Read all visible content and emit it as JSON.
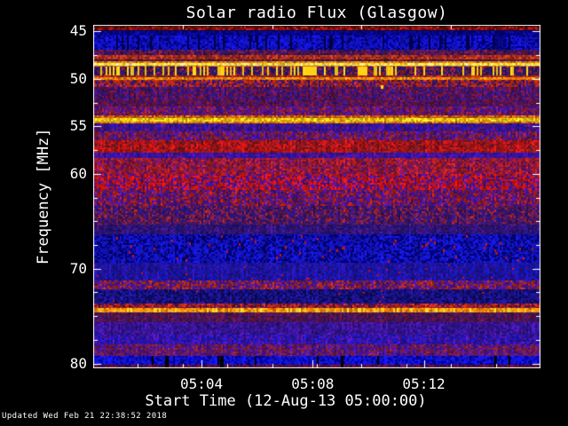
{
  "title": "Solar radio Flux (Glasgow)",
  "updated_note": "Updated Wed Feb 21 22:38:52 2018",
  "chart_data": {
    "type": "heatmap",
    "title": "Solar radio Flux (Glasgow)",
    "xlabel": "Start Time (12-Aug-13 05:00:00)",
    "ylabel": "Frequency [MHz]",
    "legend": "none",
    "grid": false,
    "colors": {
      "text": "#ffffff",
      "frame": "#ffffff",
      "background": "#000000"
    },
    "x_axis": {
      "label": "Start Time (12-Aug-13 05:00:00)",
      "unit": "minutes after 05:00:00",
      "range_minutes": [
        0.1,
        16.2
      ],
      "ticks": [
        {
          "t": 4,
          "label": "05:04"
        },
        {
          "t": 8,
          "label": "05:08"
        },
        {
          "t": 12,
          "label": "05:12"
        }
      ],
      "minor_divisions_bottom": 10,
      "minor_divisions_top": 5
    },
    "y_axis": {
      "label": "Frequency [MHz]",
      "unit": "MHz",
      "range_mhz": [
        44.3,
        80.5
      ],
      "direction": "increasing-downward",
      "ticks": [
        {
          "f": 45,
          "label": "45"
        },
        {
          "f": 50,
          "label": "50"
        },
        {
          "f": 55,
          "label": "55"
        },
        {
          "f": 60,
          "label": "60"
        },
        {
          "f": 70,
          "label": "70"
        },
        {
          "f": 80,
          "label": "80"
        }
      ],
      "minor_step_mhz": 2.5
    },
    "bands": [
      {
        "f0": 44.35,
        "f1": 44.46,
        "a": "#2D0606",
        "b": "#000000",
        "pa": 0.6
      },
      {
        "f0": 44.46,
        "f1": 44.82,
        "a": "#960F0A",
        "b": "#5A0A0A",
        "pa": 0.6,
        "d": "#DC1E14",
        "dp": 0.3,
        "dh": 2
      },
      {
        "f0": 44.82,
        "f1": 44.96,
        "a": "#000064",
        "b": "#0A0A32",
        "pa": 0.6
      },
      {
        "f0": 44.96,
        "f1": 45.42,
        "a": "#0A0AA0",
        "b": "#000078",
        "pa": 0.6
      },
      {
        "f0": 45.42,
        "f1": 46.95,
        "a": "#1212CC",
        "b": "#000082",
        "pa": 0.72,
        "d": "#000046",
        "dp": 0.08,
        "dh": "full"
      },
      {
        "f0": 46.95,
        "f1": 47.52,
        "a": "#78193C",
        "b": "#28146E",
        "pa": 0.55
      },
      {
        "f0": 47.52,
        "f1": 47.95,
        "a": "#C83C14",
        "b": "#8C1E28",
        "pa": 0.6
      },
      {
        "f0": 47.95,
        "f1": 48.15,
        "a": "#32145A",
        "b": "#6E1E28",
        "pa": 0.6
      },
      {
        "f0": 48.15,
        "f1": 48.36,
        "a": "#FF8C0A",
        "b": "#DC640A",
        "pa": 0.7
      },
      {
        "f0": 48.36,
        "f1": 48.58,
        "a": "#FFE632",
        "b": "#FFF9A0",
        "pa": 0.65
      },
      {
        "f0": 48.58,
        "f1": 48.7,
        "a": "#FF7814",
        "b": "#DC500A",
        "pa": 0.6
      },
      {
        "f0": 48.7,
        "f1": 49.6,
        "a": "#28186E",
        "b": "#8C1E28",
        "pa": 0.6,
        "d": "#FFD216",
        "dp": 0.3,
        "dh": "full"
      },
      {
        "f0": 49.6,
        "f1": 49.8,
        "a": "#C02814",
        "b": "#781E28",
        "pa": 0.6
      },
      {
        "f0": 49.8,
        "f1": 50.1,
        "a": "#FF960A",
        "b": "#E1640A",
        "pa": 0.65
      },
      {
        "f0": 50.1,
        "f1": 50.85,
        "a": "#B42814",
        "b": "#3C1478",
        "pa": 0.6
      },
      {
        "f0": 50.85,
        "f1": 52.25,
        "a": "#3C1478",
        "b": "#7A143C",
        "pa": 0.65
      },
      {
        "f0": 52.25,
        "f1": 52.95,
        "a": "#6E143C",
        "b": "#3C1478",
        "pa": 0.55
      },
      {
        "f0": 52.95,
        "f1": 53.85,
        "a": "#50148C",
        "b": "#961E28",
        "pa": 0.65
      },
      {
        "f0": 53.85,
        "f1": 54.1,
        "a": "#DC780F",
        "b": "#B43C0A",
        "pa": 0.6
      },
      {
        "f0": 54.1,
        "f1": 54.5,
        "a": "#FFDC1E",
        "b": "#FFAA00",
        "pa": 0.7,
        "d": "#96B414",
        "dp": 0.12,
        "dh": 2
      },
      {
        "f0": 54.5,
        "f1": 54.72,
        "a": "#FF960A",
        "b": "#C85A0A",
        "pa": 0.6
      },
      {
        "f0": 54.72,
        "f1": 55.5,
        "a": "#2A14A0",
        "b": "#5A1478",
        "pa": 0.6
      },
      {
        "f0": 55.5,
        "f1": 56.45,
        "a": "#8C1E28",
        "b": "#4614A0",
        "pa": 0.5
      },
      {
        "f0": 56.45,
        "f1": 57.75,
        "a": "#BE1414",
        "b": "#6E1A28",
        "pa": 0.7
      },
      {
        "f0": 57.75,
        "f1": 58.35,
        "a": "#2A14B4",
        "b": "#5A148C",
        "pa": 0.6
      },
      {
        "f0": 58.35,
        "f1": 60.0,
        "a": "#6E1464",
        "b": "#B41E1E",
        "pa": 0.5
      },
      {
        "f0": 60.0,
        "f1": 61.7,
        "a": "#C81414",
        "b": "#4614A0",
        "pa": 0.62
      },
      {
        "f0": 61.7,
        "f1": 63.4,
        "a": "#4B148C",
        "b": "#AA1E14",
        "pa": 0.62
      },
      {
        "f0": 63.4,
        "f1": 65.3,
        "a": "#32147A",
        "b": "#821E3C",
        "pa": 0.6,
        "d": "#C12814",
        "dp": 0.2,
        "dh": 3
      },
      {
        "f0": 65.3,
        "f1": 66.4,
        "a": "#201478",
        "b": "#461478",
        "pa": 0.6
      },
      {
        "f0": 66.4,
        "f1": 69.4,
        "a": "#1414C8",
        "b": "#000073",
        "pa": 0.65,
        "d": "#C81414",
        "dp": 0.18,
        "dh": 3
      },
      {
        "f0": 69.4,
        "f1": 71.2,
        "a": "#2A14A0",
        "b": "#1414AA",
        "pa": 0.5,
        "d": "#C81414",
        "dp": 0.08,
        "dh": 2
      },
      {
        "f0": 71.2,
        "f1": 72.2,
        "a": "#4B1490",
        "b": "#AA2814",
        "pa": 0.6
      },
      {
        "f0": 72.2,
        "f1": 73.7,
        "a": "#1E1496",
        "b": "#0A0A5A",
        "pa": 0.6,
        "d": "#C81414",
        "dp": 0.06,
        "dh": 2
      },
      {
        "f0": 73.7,
        "f1": 74.1,
        "a": "#5A1450",
        "b": "#C82814",
        "pa": 0.5
      },
      {
        "f0": 74.1,
        "f1": 74.62,
        "a": "#FFA014",
        "b": "#FF7800",
        "pa": 0.6,
        "d": "#FFDC28",
        "dp": 0.2,
        "dh": "full"
      },
      {
        "f0": 74.62,
        "f1": 75.6,
        "a": "#3C1464",
        "b": "#64143C",
        "pa": 0.6
      },
      {
        "f0": 75.6,
        "f1": 76.9,
        "a": "#4614A0",
        "b": "#28148C",
        "pa": 0.55
      },
      {
        "f0": 76.9,
        "f1": 78.0,
        "a": "#2014B4",
        "b": "#5014A0",
        "pa": 0.6
      },
      {
        "f0": 78.0,
        "f1": 79.2,
        "a": "#4614A0",
        "b": "#821E3C",
        "pa": 0.55
      },
      {
        "f0": 79.2,
        "f1": 80.12,
        "a": "#1414DC",
        "b": "#0000A0",
        "pa": 0.72,
        "d": "#000000",
        "dp": 0.03,
        "dh": "full"
      },
      {
        "f0": 80.12,
        "f1": 80.5,
        "a": "#6E0F28",
        "b": "#28143C",
        "pa": 0.6
      }
    ],
    "patches": [
      {
        "f0": 48.7,
        "f1": 49.6,
        "t0": 7.75,
        "t1": 8.15,
        "color": "#FFD216"
      },
      {
        "f0": 48.7,
        "f1": 49.6,
        "t0": 9.62,
        "t1": 9.98,
        "color": "#FFD216"
      },
      {
        "f0": 50.65,
        "f1": 51.0,
        "t0": 10.45,
        "t1": 10.56,
        "color": "#FFDC28"
      },
      {
        "f0": 45.0,
        "f1": 46.9,
        "t0": 14.55,
        "t1": 14.95,
        "color": "#000050",
        "alpha": 0.55
      },
      {
        "f0": 79.2,
        "f1": 80.45,
        "t0": 2.7,
        "t1": 2.8,
        "color": "#000000"
      },
      {
        "f0": 79.2,
        "f1": 80.45,
        "t0": 4.68,
        "t1": 4.78,
        "color": "#000000"
      },
      {
        "f0": 79.2,
        "f1": 80.45,
        "t0": 9.0,
        "t1": 9.1,
        "color": "#000000"
      },
      {
        "f0": 79.2,
        "f1": 80.45,
        "t0": 14.55,
        "t1": 14.62,
        "color": "#000000"
      }
    ]
  }
}
